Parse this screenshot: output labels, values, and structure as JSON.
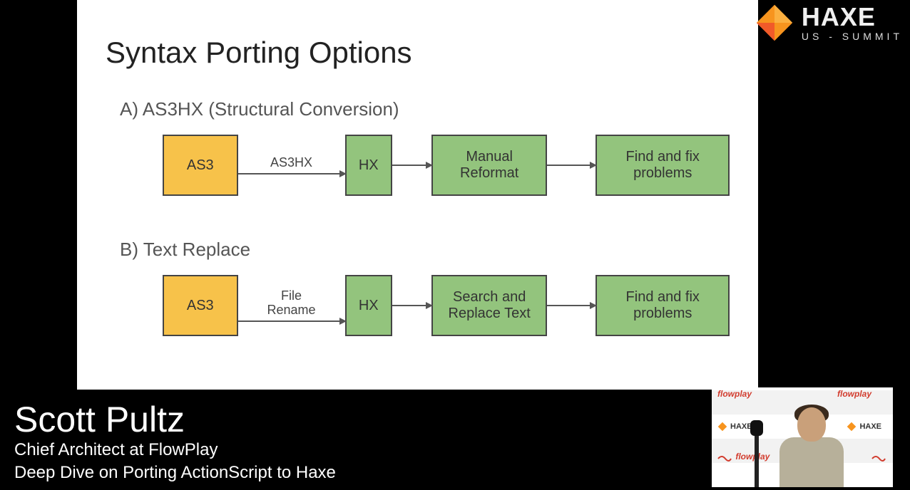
{
  "event_logo": {
    "main": "HAXE",
    "sub": "US - SUMMIT"
  },
  "slide": {
    "title": "Syntax Porting Options",
    "option_a": {
      "label": "A)  AS3HX (Structural Conversion)",
      "flow": {
        "box1": "AS3",
        "arrow1_label": "AS3HX",
        "box2": "HX",
        "arrow2_label": "",
        "box3": "Manual Reformat",
        "arrow3_label": "",
        "box4": "Find and fix problems"
      }
    },
    "option_b": {
      "label": "B)   Text Replace",
      "flow": {
        "box1": "AS3",
        "arrow1_label": "File\nRename",
        "box2": "HX",
        "arrow2_label": "",
        "box3": "Search and Replace Text",
        "arrow3_label": "",
        "box4": "Find and fix problems"
      }
    }
  },
  "lower_third": {
    "name": "Scott Pultz",
    "role": "Chief Architect at FlowPlay",
    "talk": "Deep Dive on Porting ActionScript to Haxe"
  },
  "pip": {
    "logo_text": "HAXE",
    "flow_text": "flowplay"
  }
}
